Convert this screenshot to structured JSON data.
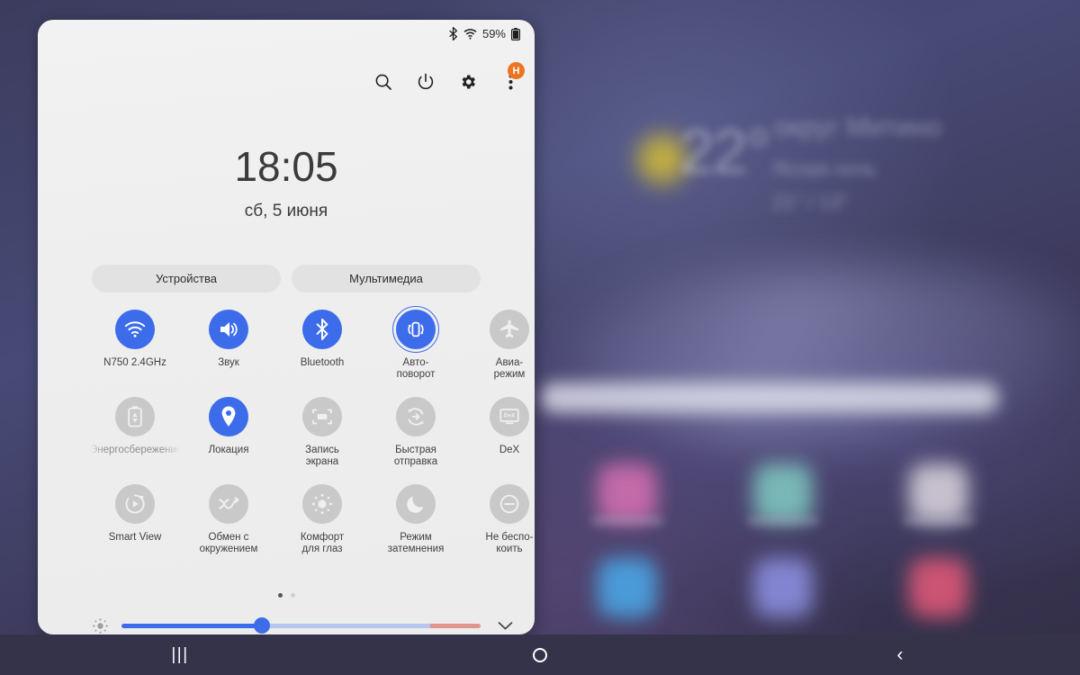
{
  "wallpaper": {
    "weather": {
      "temperature": "22°",
      "place": "округ Митино",
      "condition": "Ясная ночь",
      "high_low": "21° / 13°"
    },
    "app_icon_colors": [
      "#d46fb0",
      "#7fc8c0",
      "#d8d2dc",
      "#4aa7e8",
      "#8b8fe0",
      "#e05878"
    ]
  },
  "status_bar": {
    "bluetooth_icon": "bluetooth-icon",
    "wifi_icon": "wifi-icon",
    "battery_percent": "59%",
    "battery_icon": "battery-icon"
  },
  "header": {
    "search_icon": "search-icon",
    "power_icon": "power-icon",
    "settings_icon": "gear-icon",
    "overflow_icon": "three-dots-icon",
    "avatar_initial": "H",
    "avatar_color": "#ec7524"
  },
  "clock": {
    "time": "18:05",
    "date": "сб, 5 июня"
  },
  "chips": [
    {
      "label": "Устройства"
    },
    {
      "label": "Мультимедиа"
    }
  ],
  "toggles": [
    {
      "label": "N750 2.4GHz",
      "icon": "wifi-icon",
      "state": "on",
      "ring": false,
      "label_style": "normal"
    },
    {
      "label": "Звук",
      "icon": "sound-icon",
      "state": "on",
      "ring": false,
      "label_style": "normal"
    },
    {
      "label": "Bluetooth",
      "icon": "bluetooth-icon",
      "state": "on",
      "ring": false,
      "label_style": "normal"
    },
    {
      "label": "Авто-\nповорот",
      "icon": "auto-rotate-icon",
      "state": "on",
      "ring": true,
      "label_style": "normal"
    },
    {
      "label": "Авиа-\nрежим",
      "icon": "airplane-icon",
      "state": "off",
      "ring": false,
      "label_style": "normal"
    },
    {
      "label": "Энергосбережение",
      "icon": "battery-saver-icon",
      "state": "off",
      "ring": false,
      "label_style": "faded"
    },
    {
      "label": "Локация",
      "icon": "location-pin-icon",
      "state": "on",
      "ring": false,
      "label_style": "normal"
    },
    {
      "label": "Запись\nэкрана",
      "icon": "screen-record-icon",
      "state": "off",
      "ring": false,
      "label_style": "normal"
    },
    {
      "label": "Быстрая\nотправка",
      "icon": "quick-share-icon",
      "state": "off",
      "ring": false,
      "label_style": "normal"
    },
    {
      "label": "DeX",
      "icon": "dex-icon",
      "state": "off",
      "ring": false,
      "label_style": "normal"
    },
    {
      "label": "Smart View",
      "icon": "smart-view-icon",
      "state": "off",
      "ring": false,
      "label_style": "normal"
    },
    {
      "label": "Обмен с\nокружением",
      "icon": "nearby-share-icon",
      "state": "off",
      "ring": false,
      "label_style": "normal"
    },
    {
      "label": "Комфорт\nдля глаз",
      "icon": "eye-comfort-icon",
      "state": "off",
      "ring": false,
      "label_style": "normal"
    },
    {
      "label": "Режим\nзатемнения",
      "icon": "dark-mode-icon",
      "state": "off",
      "ring": false,
      "label_style": "normal"
    },
    {
      "label": "Не беспо-\nкоить",
      "icon": "do-not-disturb-icon",
      "state": "off",
      "ring": false,
      "label_style": "normal"
    }
  ],
  "page_dots": {
    "count": 2,
    "active_index": 0
  },
  "brightness": {
    "low_icon": "brightness-low-icon",
    "value_percent": 39,
    "expand_icon": "chevron-down-icon"
  },
  "nav_bar": {
    "recents_glyph": "|||",
    "recents_name": "recent-apps-button",
    "home_name": "home-button",
    "back_glyph": "‹",
    "back_name": "back-button"
  },
  "colors": {
    "accent_blue": "#3d6ceb",
    "inactive_gray": "#c9c9c9",
    "panel_bg": "#efefef",
    "navbar_bg": "#35334a"
  }
}
